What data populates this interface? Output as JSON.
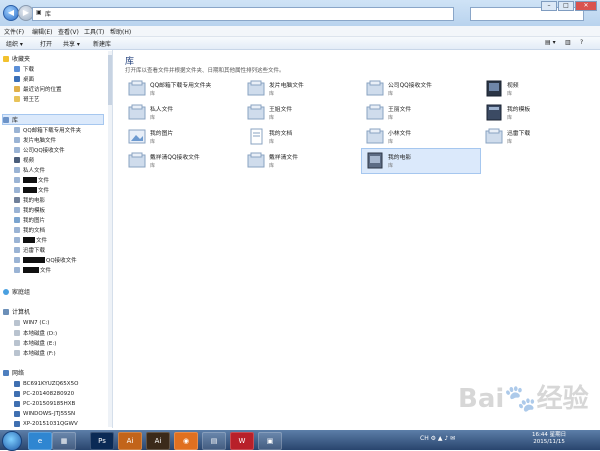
{
  "address": {
    "back_icon": "back-arrow-icon",
    "path_label": "库"
  },
  "menu": {
    "file": "文件(F)",
    "edit": "编辑(E)",
    "view": "查看(V)",
    "tools": "工具(T)",
    "help": "帮助(H)"
  },
  "toolbar": {
    "organize": "组织 ▾",
    "open": "打开",
    "share": "共享 ▾",
    "new_folder": "新建库"
  },
  "sidebar": {
    "favorites": {
      "title": "收藏夹",
      "items": [
        "下载",
        "桌面",
        "最近访问的位置",
        "哥王艺"
      ]
    },
    "libraries": {
      "title": "库",
      "items": [
        "QQ邮箱下载专用文件夹",
        "发片电脑文件",
        "公司QQ接收文件",
        "视频",
        "私人文件",
        "文件",
        "文件",
        "我的电影",
        "我的模板",
        "我的图片",
        "我的文档",
        "文件",
        "迅雷下载",
        "QQ接收文件",
        "文件"
      ]
    },
    "homegroup": "家庭组",
    "computer": {
      "title": "计算机",
      "items": [
        "WIN7 (C:)",
        "本地磁盘 (D:)",
        "本地磁盘 (E:)",
        "本地磁盘 (F:)"
      ]
    },
    "network": {
      "title": "网络",
      "items": [
        "BC691KYUZQ65X5O",
        "PC-201408280920",
        "PC-201509185HXB",
        "WINDOWS-JTJ55SN",
        "XP-20151031QGWV"
      ]
    }
  },
  "main": {
    "title": "库",
    "subtitle": "打开库以查看文件并根据文件夹、日期和其他属性排列这些文件。",
    "tiles": [
      {
        "name": "QQ邮箱下载专用文件夹",
        "sub": "库"
      },
      {
        "name": "发片电脑文件",
        "sub": "库"
      },
      {
        "name": "公司QQ接收文件",
        "sub": "库"
      },
      {
        "name": "视频",
        "sub": "库"
      },
      {
        "name": "私人文件",
        "sub": "库"
      },
      {
        "name": "王姐文件",
        "sub": "库"
      },
      {
        "name": "王丽文件",
        "sub": "库"
      },
      {
        "name": "我的模板",
        "sub": "库"
      },
      {
        "name": "我的图片",
        "sub": "库"
      },
      {
        "name": "我的文档",
        "sub": "库"
      },
      {
        "name": "小林文件",
        "sub": "库"
      },
      {
        "name": "迅雷下载",
        "sub": "库"
      },
      {
        "name": "戴祥清QQ接收文件",
        "sub": "库"
      },
      {
        "name": "戴祥清文件",
        "sub": "库"
      },
      {
        "name": "我的电影",
        "sub": "库"
      }
    ]
  },
  "taskbar": {
    "time": "16:44 星期日",
    "date": "2015/11/15",
    "lang": "CH"
  },
  "colors": {
    "selection": "#dbe9fb",
    "accent": "#1e3d7a"
  }
}
